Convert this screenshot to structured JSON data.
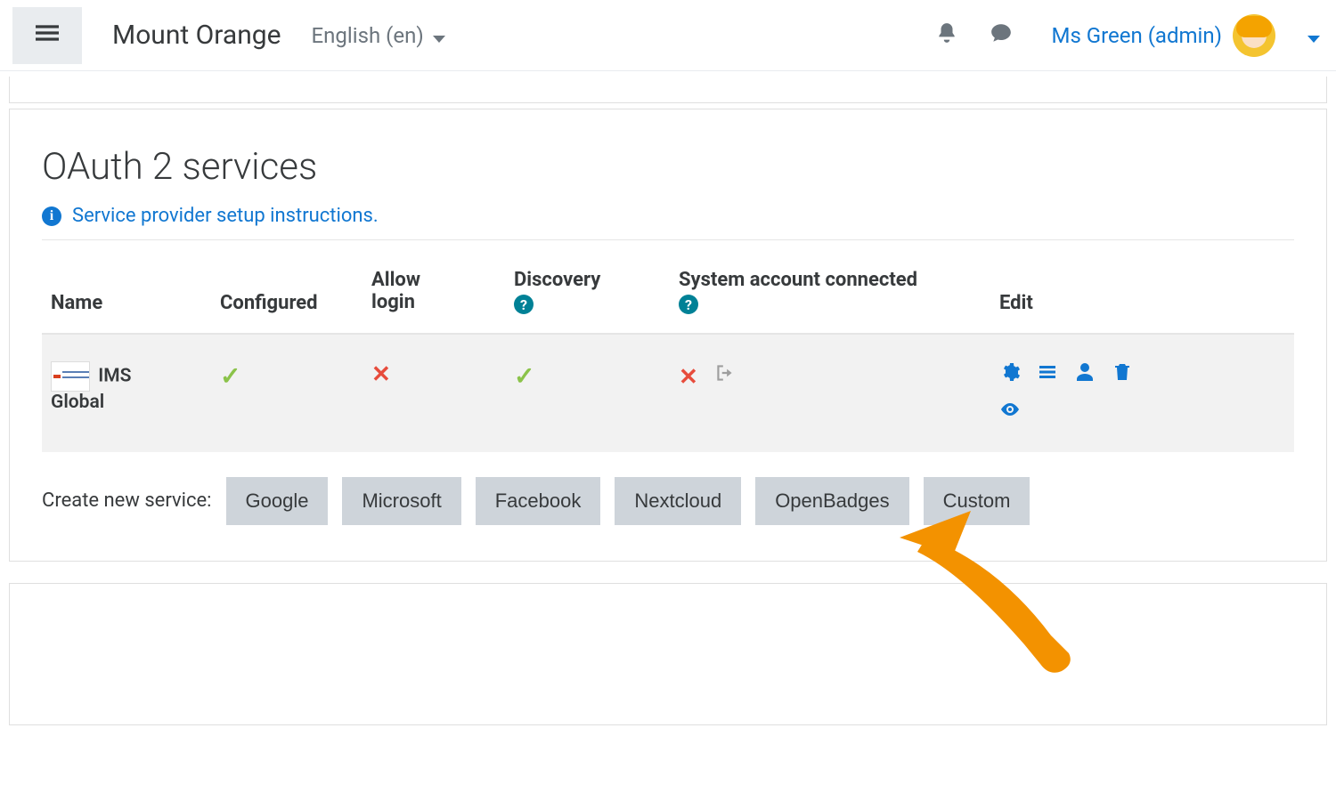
{
  "nav": {
    "brand": "Mount Orange",
    "language": "English (en)",
    "user_name": "Ms Green (admin)"
  },
  "page": {
    "title": "OAuth 2 services",
    "setup_link": "Service provider setup instructions."
  },
  "table": {
    "headers": {
      "name": "Name",
      "configured": "Configured",
      "allow_login_l1": "Allow",
      "allow_login_l2": "login",
      "discovery": "Discovery",
      "system_account": "System account connected",
      "edit": "Edit"
    },
    "row": {
      "name_l1": "IMS",
      "name_l2": "Global"
    }
  },
  "create": {
    "label": "Create new service:",
    "buttons": [
      "Google",
      "Microsoft",
      "Facebook",
      "Nextcloud",
      "OpenBadges",
      "Custom"
    ]
  }
}
